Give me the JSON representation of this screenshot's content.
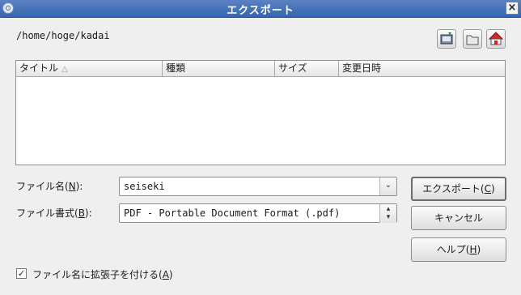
{
  "window": {
    "title": "エクスポート",
    "menu_icon": "window-menu-icon",
    "close_symbol": "×"
  },
  "path": "/home/hoge/kadai",
  "toolbar": {
    "icons": [
      "desktop-folder-icon",
      "new-folder-icon",
      "home-icon"
    ]
  },
  "file_list": {
    "columns": [
      "タイトル",
      "種類",
      "サイズ",
      "変更日時"
    ],
    "sort_indicator": "△",
    "rows": []
  },
  "form": {
    "filename_label": "ファイル名(",
    "filename_mnemonic": "N",
    "filename_label_end": "):",
    "filename_value": "seiseki",
    "format_label": "ファイル書式(",
    "format_mnemonic": "B",
    "format_label_end": "):",
    "format_value": "PDF - Portable Document Format (.pdf)"
  },
  "buttons": {
    "export": "エクスポート(",
    "export_mnemonic": "C",
    "export_end": ")",
    "cancel": "キャンセル",
    "help": "ヘルプ(",
    "help_mnemonic": "H",
    "help_end": ")"
  },
  "extension_checkbox": {
    "checked": true,
    "label": "ファイル名に拡張子を付ける(",
    "mnemonic": "A",
    "label_end": ")"
  },
  "colors": {
    "titlebar": "#3f6db6",
    "background": "#efefef"
  }
}
